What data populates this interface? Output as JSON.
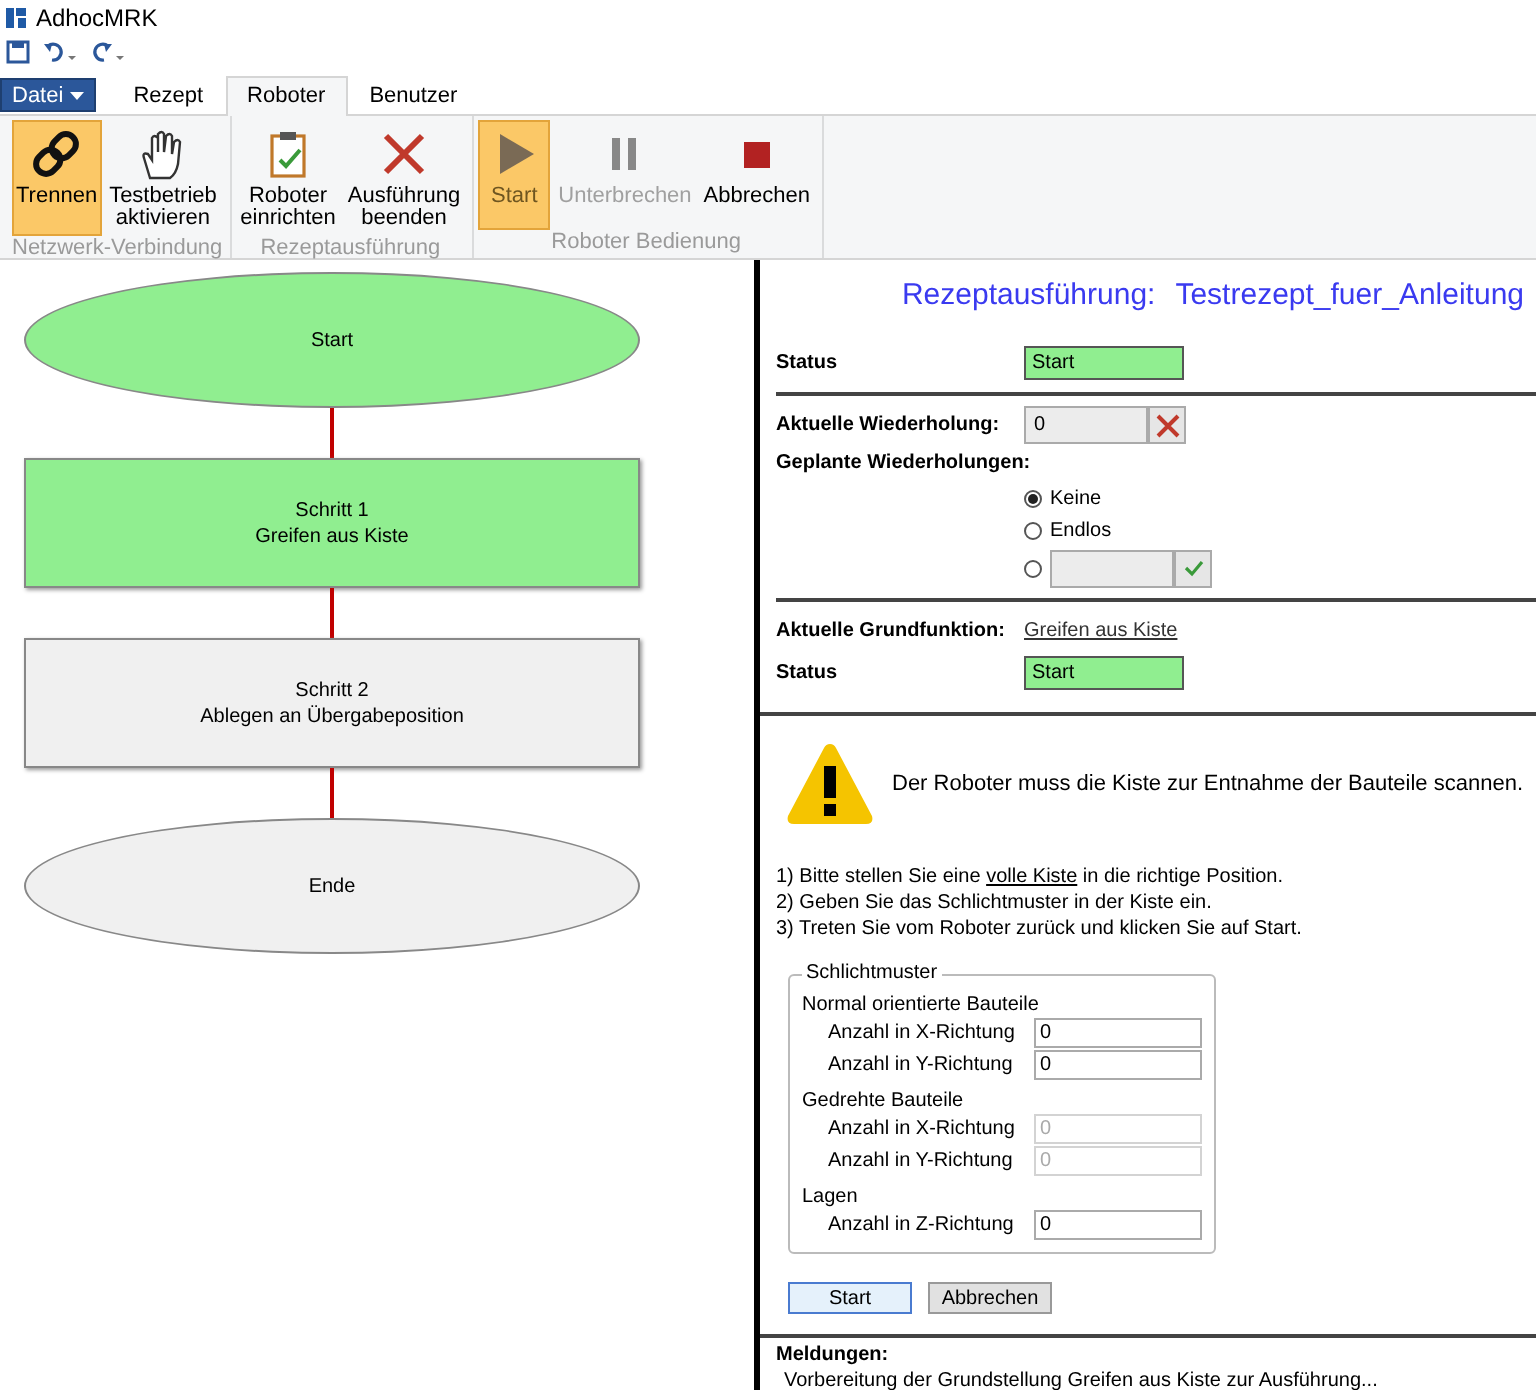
{
  "window": {
    "title": "AdhocMRK"
  },
  "file_menu": {
    "label": "Datei"
  },
  "tabs": [
    {
      "label": "Rezept",
      "selected": false
    },
    {
      "label": "Roboter",
      "selected": true
    },
    {
      "label": "Benutzer",
      "selected": false
    }
  ],
  "ribbon": {
    "groups": [
      {
        "label": "Netzwerk-Verbindung",
        "buttons": [
          {
            "kind": "link",
            "label": "Trennen",
            "active": true,
            "disabled": false
          },
          {
            "kind": "hand",
            "label": "Testbetrieb\naktivieren",
            "active": false,
            "disabled": false
          }
        ]
      },
      {
        "label": "Rezeptausführung",
        "buttons": [
          {
            "kind": "clipboard",
            "label": "Roboter\neinrichten",
            "active": false,
            "disabled": false
          },
          {
            "kind": "cross",
            "label": "Ausführung\nbeenden",
            "active": false,
            "disabled": false
          }
        ]
      },
      {
        "label": "Roboter Bedienung",
        "buttons": [
          {
            "kind": "play",
            "label": "Start",
            "active": true,
            "disabled": true
          },
          {
            "kind": "pause",
            "label": "Unterbrechen",
            "active": false,
            "disabled": true
          },
          {
            "kind": "stop",
            "label": "Abbrechen",
            "active": false,
            "disabled": false
          }
        ]
      }
    ]
  },
  "flowchart": {
    "nodes": [
      {
        "kind": "terminal",
        "label": "Start",
        "color": "#90ee90"
      },
      {
        "kind": "step",
        "label": "Schritt 1\nGreifen aus Kiste",
        "color": "#90ee90"
      },
      {
        "kind": "step",
        "label": "Schritt 2\nAblegen an Übergabeposition",
        "color": "#f0f0f0"
      },
      {
        "kind": "terminal",
        "label": "Ende",
        "color": "#f0f0f0"
      }
    ]
  },
  "execution": {
    "heading": "Rezeptausführung:",
    "recipe": "Testrezept_fuer_Anleitung",
    "status": {
      "label": "Status",
      "value": "Start"
    },
    "current_repetition": {
      "label": "Aktuelle Wiederholung:",
      "value": "0"
    },
    "planned_repetitions": {
      "label": "Geplante Wiederholungen:",
      "options": [
        {
          "kind": "text",
          "label": "Keine",
          "selected": true
        },
        {
          "kind": "text",
          "label": "Endlos",
          "selected": false
        },
        {
          "kind": "custom",
          "selected": false
        }
      ]
    },
    "current_function": {
      "label": "Aktuelle Grundfunktion:",
      "link": "Greifen aus Kiste"
    },
    "function_status": {
      "label": "Status",
      "value": "Start"
    },
    "warning": "Der Roboter muss die Kiste zur Entnahme der Bauteile scannen.",
    "instructions": [
      {
        "before": "1) Bitte stellen Sie eine ",
        "link": "volle Kiste",
        "after": " in die richtige Position."
      },
      {
        "before": "2) Geben Sie das Schlichtmuster in der Kiste ein."
      },
      {
        "before": "3) Treten Sie vom Roboter zurück und klicken Sie auf Start."
      }
    ],
    "pattern": {
      "legend": "Schlichtmuster",
      "sections": [
        {
          "title": "Normal orientierte Bauteile",
          "fields": [
            {
              "label": "Anzahl in X-Richtung",
              "value": "0",
              "disabled": false
            },
            {
              "label": "Anzahl in Y-Richtung",
              "value": "0",
              "disabled": false
            }
          ]
        },
        {
          "title": "Gedrehte Bauteile",
          "fields": [
            {
              "label": "Anzahl in X-Richtung",
              "value": "0",
              "disabled": true
            },
            {
              "label": "Anzahl in Y-Richtung",
              "value": "0",
              "disabled": true
            }
          ]
        },
        {
          "title": "Lagen",
          "fields": [
            {
              "label": "Anzahl in Z-Richtung",
              "value": "0",
              "disabled": false
            }
          ]
        }
      ]
    },
    "buttons": [
      {
        "label": "Start",
        "default": true
      },
      {
        "label": "Abbrechen",
        "default": false
      }
    ],
    "messages": {
      "label": "Meldungen:",
      "text": "Vorbereitung der Grundstellung Greifen aus Kiste zur Ausführung..."
    }
  }
}
